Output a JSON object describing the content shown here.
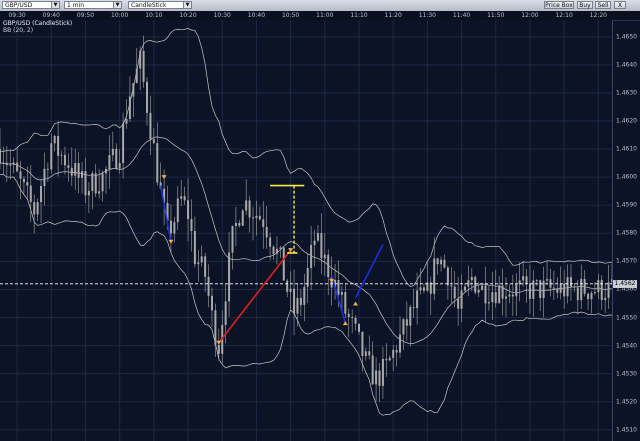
{
  "toolbar": {
    "symbol": "GBP/USD",
    "interval": "1 min",
    "chart_type": "CandleStick",
    "price_box_label": "Price Box",
    "buy_label": "Buy",
    "sell_label": "Sell",
    "close_glyph": "X"
  },
  "chart": {
    "title": "GBP/USD (CandleStick)",
    "indicator": "BB (20, 2)",
    "current_price": "1.4562",
    "time_labels": [
      "09:30",
      "09:40",
      "09:50",
      "10:00",
      "10:10",
      "10:20",
      "10:30",
      "10:40",
      "10:50",
      "11:00",
      "11:10",
      "11:20",
      "11:30",
      "11:40",
      "11:50",
      "12:00",
      "12:10",
      "12:20"
    ],
    "price_labels": [
      "1.4650",
      "1.4640",
      "1.4630",
      "1.4620",
      "1.4610",
      "1.4600",
      "1.4590",
      "1.4580",
      "1.4570",
      "1.4560",
      "1.4550",
      "1.4540",
      "1.4530",
      "1.4520",
      "1.4510"
    ],
    "colors": {
      "background": "#0c1326",
      "grid": "#1d2845",
      "candle": "#a9a9a9",
      "band": "#c8c8c8",
      "red_line": "#e0201c",
      "blue_line": "#1c2fd8",
      "yellow": "#f3ee3a",
      "arrow": "#f0b040"
    }
  },
  "chart_data": {
    "type": "candlestick",
    "symbol": "GBP/USD",
    "interval": "1 min",
    "x_range": [
      "09:25",
      "12:24"
    ],
    "ylim": [
      1.4506,
      1.4656
    ],
    "indicator": "BB (20, 2)",
    "close_path": [
      [
        "09:25",
        1.461
      ],
      [
        "09:30",
        1.46
      ],
      [
        "09:35",
        1.4588
      ],
      [
        "09:40",
        1.4612
      ],
      [
        "09:45",
        1.4605
      ],
      [
        "09:50",
        1.4596
      ],
      [
        "09:55",
        1.46
      ],
      [
        "10:00",
        1.461
      ],
      [
        "10:03",
        1.463
      ],
      [
        "10:06",
        1.4641
      ],
      [
        "10:09",
        1.4618
      ],
      [
        "10:12",
        1.4594
      ],
      [
        "10:14",
        1.458
      ],
      [
        "10:16",
        1.4585
      ],
      [
        "10:18",
        1.4592
      ],
      [
        "10:20",
        1.4587
      ],
      [
        "10:22",
        1.4572
      ],
      [
        "10:25",
        1.4565
      ],
      [
        "10:27",
        1.455
      ],
      [
        "10:29",
        1.454
      ],
      [
        "10:31",
        1.456
      ],
      [
        "10:33",
        1.4578
      ],
      [
        "10:36",
        1.4592
      ],
      [
        "10:39",
        1.4588
      ],
      [
        "10:42",
        1.4585
      ],
      [
        "10:45",
        1.4576
      ],
      [
        "10:47",
        1.457
      ],
      [
        "10:49",
        1.456
      ],
      [
        "10:51",
        1.4552
      ],
      [
        "10:53",
        1.4556
      ],
      [
        "10:55",
        1.4566
      ],
      [
        "10:57",
        1.4578
      ],
      [
        "11:00",
        1.457
      ],
      [
        "11:03",
        1.4562
      ],
      [
        "11:06",
        1.4552
      ],
      [
        "11:09",
        1.4544
      ],
      [
        "11:12",
        1.4534
      ],
      [
        "11:15",
        1.4528
      ],
      [
        "11:18",
        1.4532
      ],
      [
        "11:21",
        1.454
      ],
      [
        "11:24",
        1.4548
      ],
      [
        "11:27",
        1.4556
      ],
      [
        "11:30",
        1.4558
      ],
      [
        "11:33",
        1.4572
      ],
      [
        "11:36",
        1.4566
      ],
      [
        "11:39",
        1.4552
      ],
      [
        "11:43",
        1.4564
      ],
      [
        "11:46",
        1.456
      ]
    ]
  }
}
